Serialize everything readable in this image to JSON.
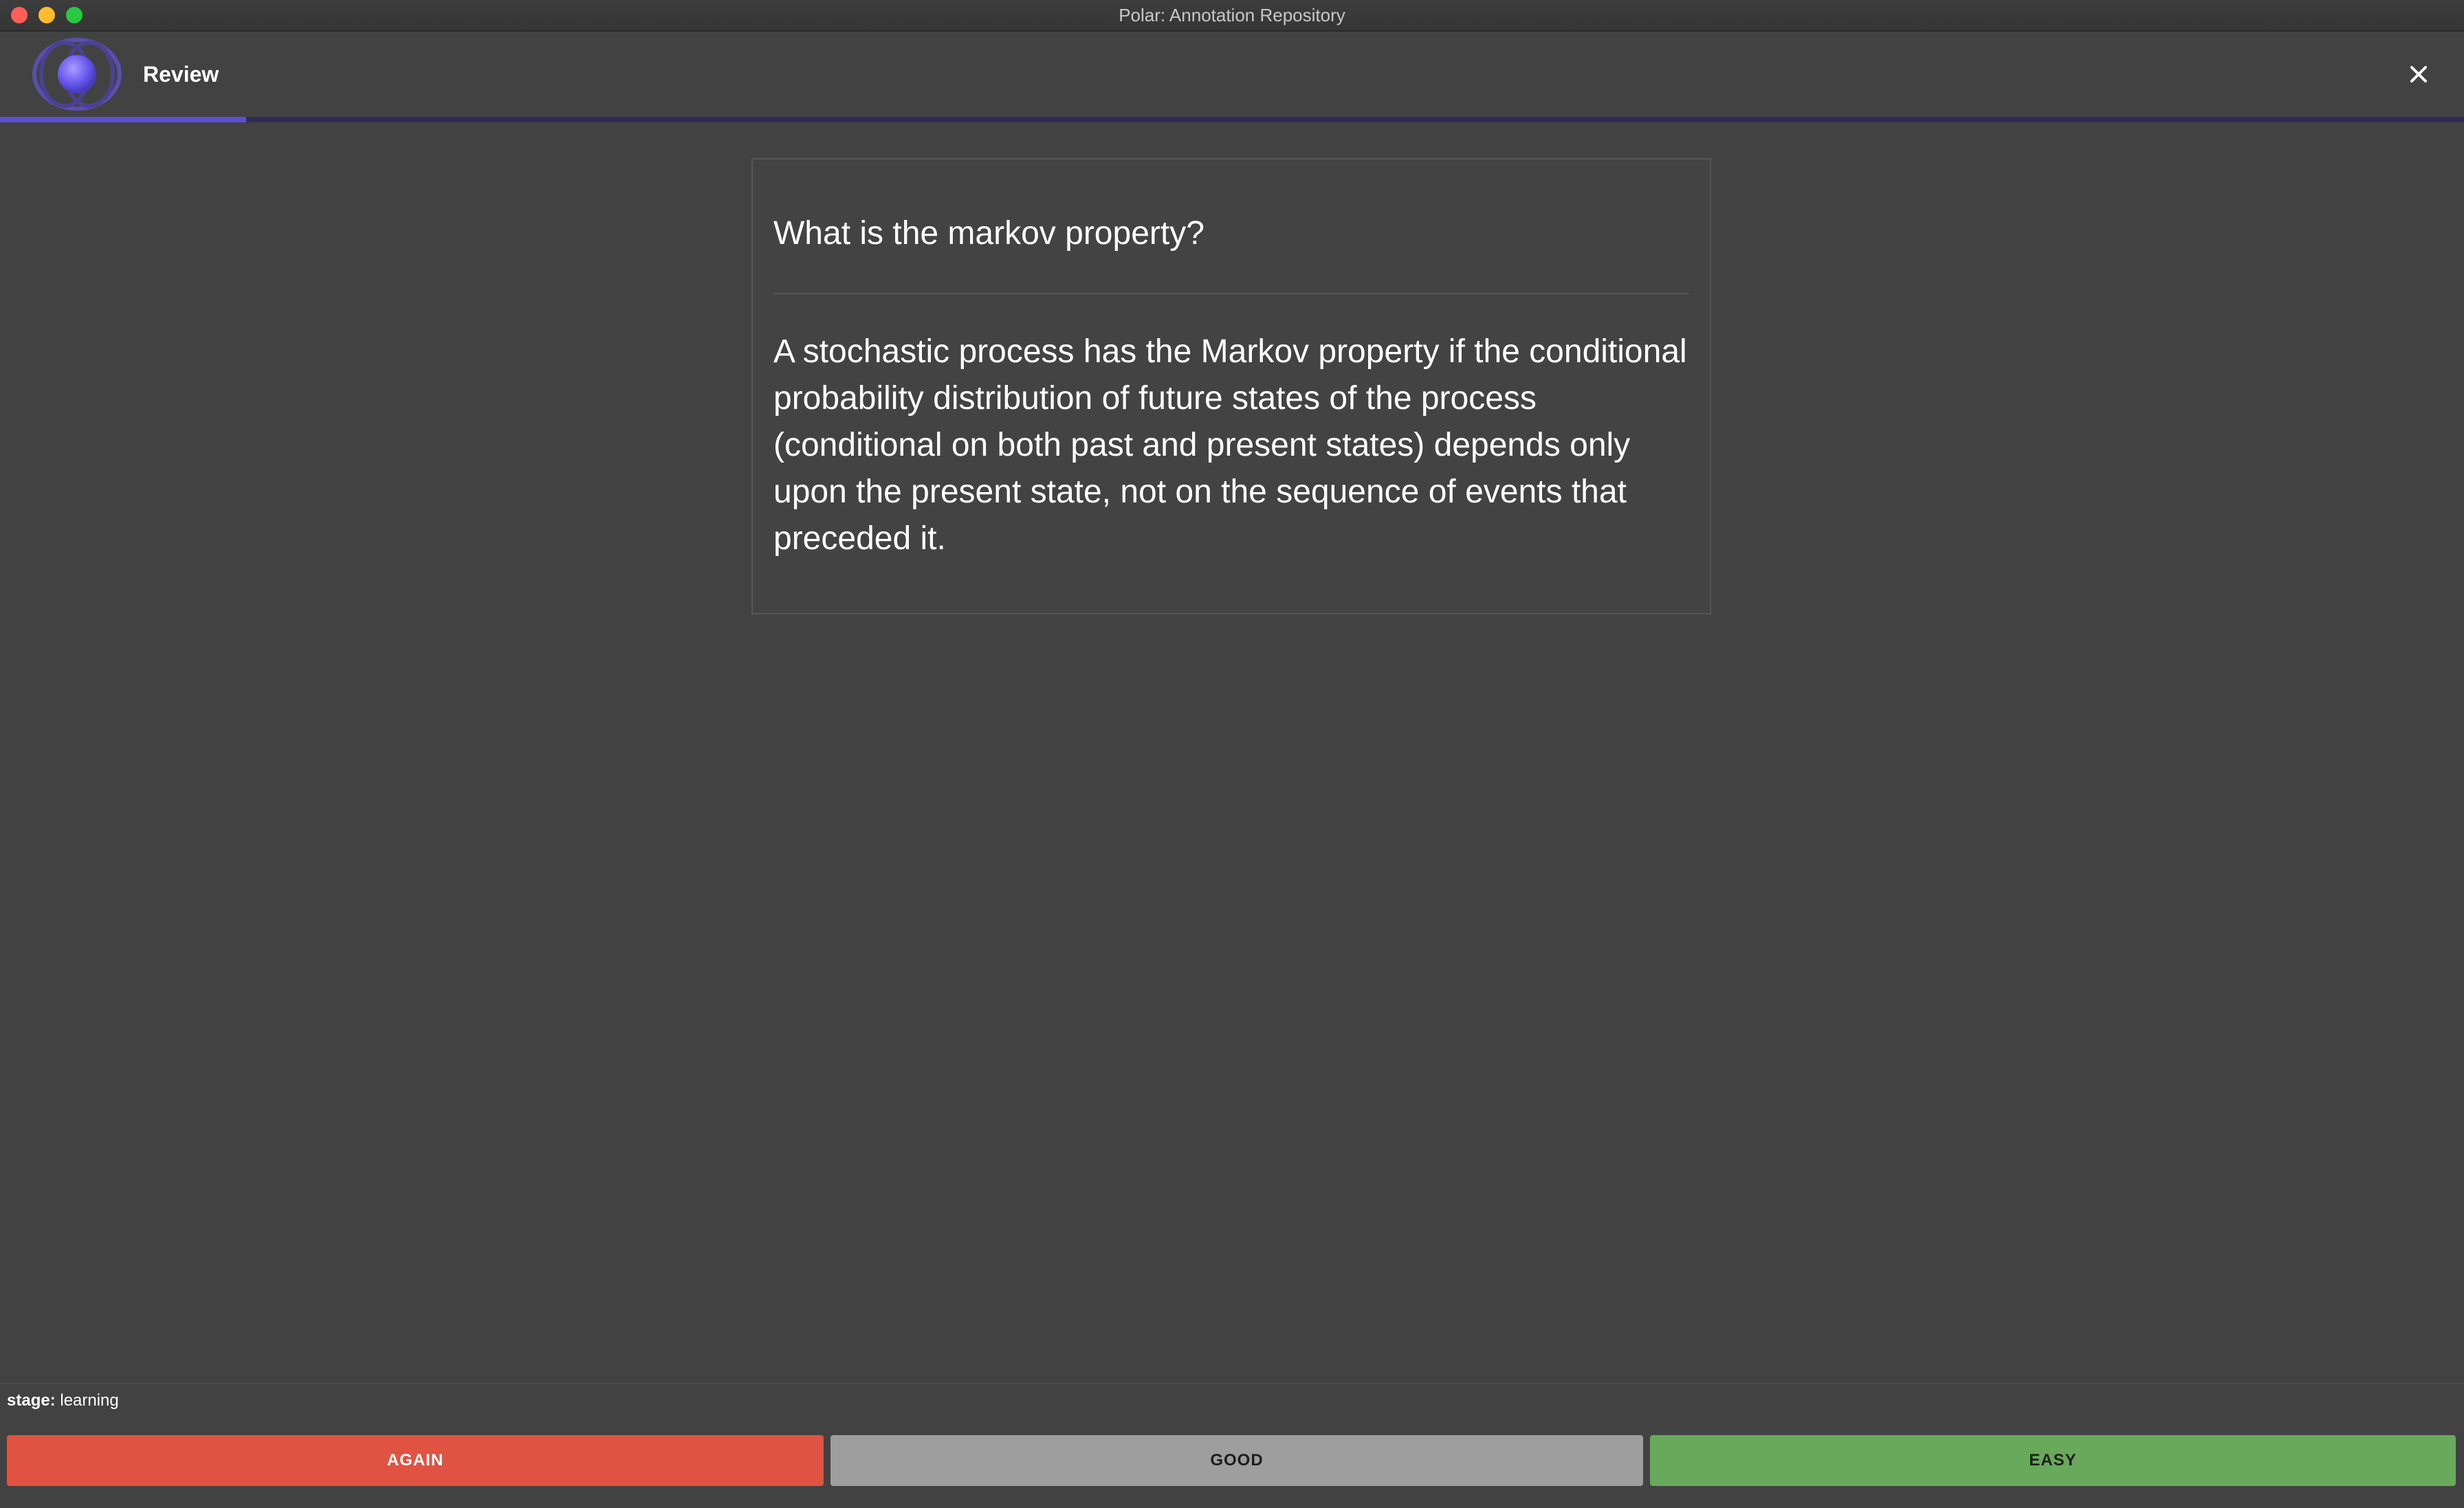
{
  "window": {
    "title": "Polar: Annotation Repository"
  },
  "header": {
    "title": "Review",
    "logo_icon": "polar-logo-icon",
    "close_icon": "close-icon",
    "progress": 0.1
  },
  "card": {
    "question": "What is the markov property?",
    "answer": "A stochastic process has the Markov property if the conditional probability distribution of future states of the process (conditional on both past and present states) depends only upon the present state, not on the sequence of events that preceded it."
  },
  "footer": {
    "stage_label": "stage:",
    "stage_value": "learning",
    "buttons": {
      "again": "AGAIN",
      "good": "GOOD",
      "easy": "EASY"
    }
  },
  "colors": {
    "again": "#e05343",
    "good": "#9e9e9e",
    "easy": "#69a95b",
    "accent": "#5b4fd6",
    "background": "#424242"
  }
}
